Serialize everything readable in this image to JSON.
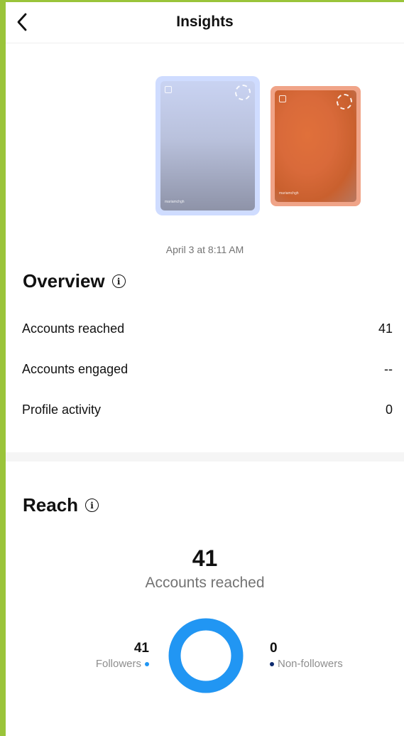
{
  "header": {
    "title": "Insights"
  },
  "stories": {
    "selected_user": "mariamchgh",
    "other_user": "mariamchgh",
    "date": "April 3 at 8:11 AM"
  },
  "overview": {
    "title": "Overview",
    "rows": [
      {
        "label": "Accounts reached",
        "value": "41"
      },
      {
        "label": "Accounts engaged",
        "value": "--"
      },
      {
        "label": "Profile activity",
        "value": "0"
      }
    ]
  },
  "reach": {
    "title": "Reach",
    "total": "41",
    "total_label": "Accounts reached",
    "followers": {
      "value": "41",
      "label": "Followers",
      "color": "#2196f3",
      "fraction": 1.0
    },
    "non_followers": {
      "value": "0",
      "label": "Non-followers",
      "color": "#0d2a6e",
      "fraction": 0.0
    }
  },
  "colors": {
    "accent": "#2196f3",
    "frame": "#9ac43a"
  }
}
